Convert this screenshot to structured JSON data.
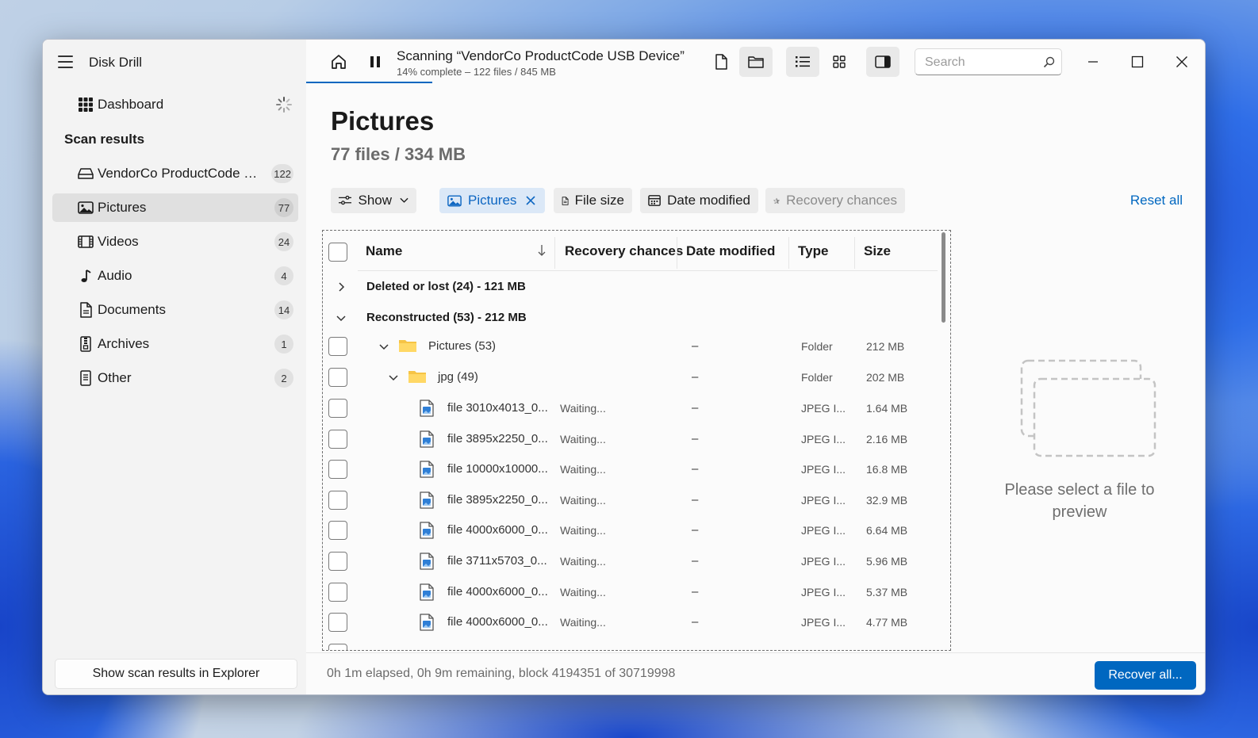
{
  "app": {
    "title": "Disk Drill"
  },
  "sidebar": {
    "dashboard_label": "Dashboard",
    "section_title": "Scan results",
    "items": [
      {
        "label": "VendorCo ProductCode US...",
        "count": "122",
        "icon": "drive-icon"
      },
      {
        "label": "Pictures",
        "count": "77",
        "icon": "image-icon",
        "active": true
      },
      {
        "label": "Videos",
        "count": "24",
        "icon": "film-icon"
      },
      {
        "label": "Audio",
        "count": "4",
        "icon": "music-note-icon"
      },
      {
        "label": "Documents",
        "count": "14",
        "icon": "document-icon"
      },
      {
        "label": "Archives",
        "count": "1",
        "icon": "archive-icon"
      },
      {
        "label": "Other",
        "count": "2",
        "icon": "file-icon"
      }
    ],
    "explorer_button": "Show scan results in Explorer"
  },
  "scan": {
    "title": "Scanning “VendorCo ProductCode USB Device”",
    "subtitle": "14% complete – 122 files / 845 MB",
    "progress": 0.14
  },
  "search": {
    "placeholder": "Search"
  },
  "page": {
    "title": "Pictures",
    "subtitle": "77 files / 334 MB"
  },
  "filters": {
    "show": "Show",
    "pictures": "Pictures",
    "file_size": "File size",
    "date_modified": "Date modified",
    "recovery_chances": "Recovery chances",
    "reset_all": "Reset all"
  },
  "table": {
    "columns": [
      "Name",
      "Recovery chances",
      "Date modified",
      "Type",
      "Size"
    ],
    "groups": [
      {
        "label": "Deleted or lost (24) - 121 MB",
        "expanded": false
      },
      {
        "label": "Reconstructed (53) - 212 MB",
        "expanded": true
      }
    ],
    "folders": [
      {
        "name": "Pictures (53)",
        "date": "–",
        "type": "Folder",
        "size": "212 MB"
      },
      {
        "name": "jpg (49)",
        "date": "–",
        "type": "Folder",
        "size": "202 MB"
      }
    ],
    "files": [
      {
        "name": "file 3010x4013_0...",
        "chances": "Waiting...",
        "date": "–",
        "type": "JPEG I...",
        "size": "1.64 MB"
      },
      {
        "name": "file 3895x2250_0...",
        "chances": "Waiting...",
        "date": "–",
        "type": "JPEG I...",
        "size": "2.16 MB"
      },
      {
        "name": "file 10000x10000...",
        "chances": "Waiting...",
        "date": "–",
        "type": "JPEG I...",
        "size": "16.8 MB"
      },
      {
        "name": "file 3895x2250_0...",
        "chances": "Waiting...",
        "date": "–",
        "type": "JPEG I...",
        "size": "32.9 MB"
      },
      {
        "name": "file 4000x6000_0...",
        "chances": "Waiting...",
        "date": "–",
        "type": "JPEG I...",
        "size": "6.64 MB"
      },
      {
        "name": "file 3711x5703_0...",
        "chances": "Waiting...",
        "date": "–",
        "type": "JPEG I...",
        "size": "5.96 MB"
      },
      {
        "name": "file 4000x6000_0...",
        "chances": "Waiting...",
        "date": "–",
        "type": "JPEG I...",
        "size": "5.37 MB"
      },
      {
        "name": "file 4000x6000_0...",
        "chances": "Waiting...",
        "date": "–",
        "type": "JPEG I...",
        "size": "4.77 MB"
      }
    ]
  },
  "preview": {
    "message": "Please select a file to preview"
  },
  "status": {
    "text": "0h 1m elapsed, 0h 9m remaining, block 4194351 of 30719998"
  },
  "actions": {
    "recover_all": "Recover all..."
  },
  "colors": {
    "accent": "#0067c0",
    "folder": "#f6c445"
  }
}
